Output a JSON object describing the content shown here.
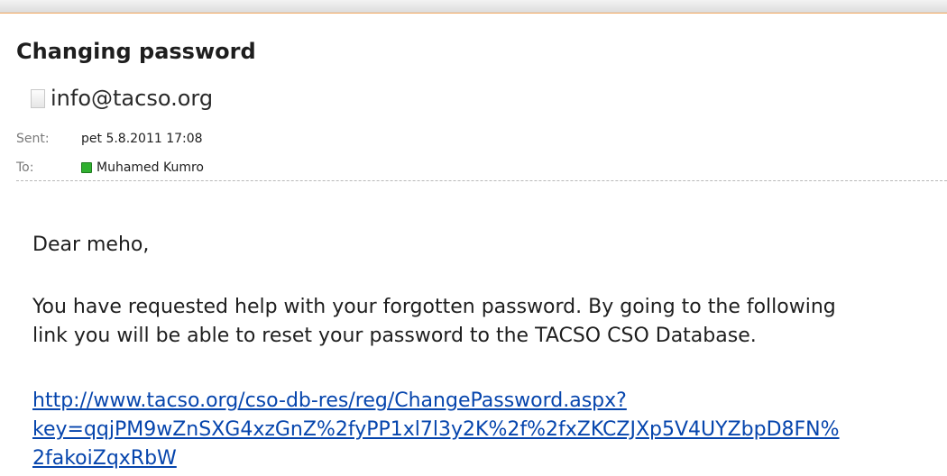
{
  "email": {
    "subject": "Changing password",
    "from": "info@tacso.org",
    "sent_label": "Sent:",
    "sent_value": "pet 5.8.2011 17:08",
    "to_label": "To:",
    "to_value": "Muhamed Kumro",
    "greeting": "Dear meho,",
    "paragraph_lines": [
      "You have requested help with your forgotten password. By going to the following",
      "link you will be able to reset your password to the TACSO CSO Database."
    ],
    "link_lines": [
      "http://www.tacso.org/cso-db-res/reg/ChangePassword.aspx?",
      "key=qqjPM9wZnSXG4xzGnZ%2fyPP1xl7l3y2K%2f%2fxZKCZJXp5V4UYZbpD8FN%",
      "2fakoiZqxRbW"
    ]
  },
  "colors": {
    "link": "#0645ad",
    "presence_online": "#30b030",
    "divider_accent": "#f0a35a"
  },
  "icons": {
    "sender_presence": "presence-unknown-icon",
    "recipient_presence": "presence-online-icon"
  }
}
